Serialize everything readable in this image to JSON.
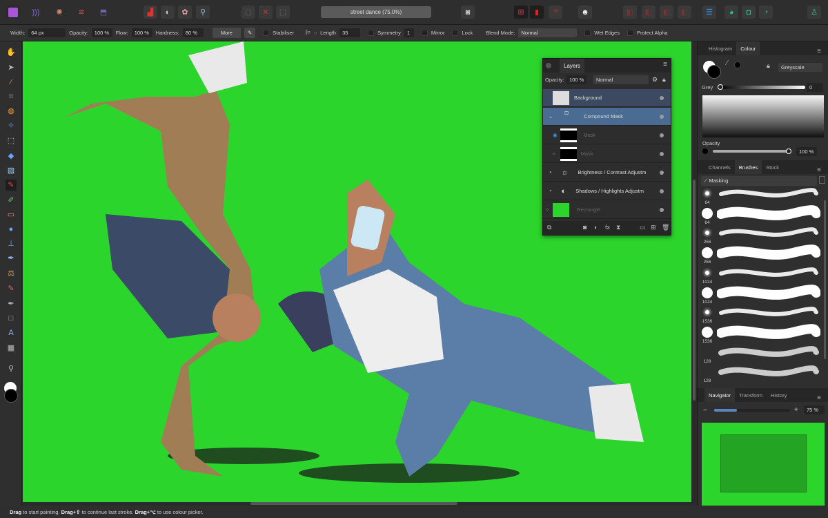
{
  "document": {
    "title": "street dance (75.0%)"
  },
  "toolbar_top": {
    "personas": [
      "photo-persona",
      "liquify-persona",
      "develop-persona",
      "tone-mapping-persona",
      "export-persona"
    ]
  },
  "context": {
    "width_label": "Width:",
    "width": "64 px",
    "opacity_label": "Opacity:",
    "opacity": "100 %",
    "flow_label": "Flow:",
    "flow": "100 %",
    "hardness_label": "Hardness:",
    "hardness": "80 %",
    "more": "More",
    "stabiliser": "Stabiliser",
    "length_label": "Length",
    "length": "35",
    "symmetry": "Symmetry",
    "symmetry_count": "1",
    "mirror": "Mirror",
    "lock": "Lock",
    "blend_label": "Blend Mode:",
    "blend": "Normal",
    "wet_edges": "Wet Edges",
    "protect_alpha": "Protect Alpha"
  },
  "layers": {
    "tab": "Layers",
    "opacity_label": "Opacity:",
    "opacity": "100 %",
    "blend": "Normal",
    "items": [
      {
        "name": "Background",
        "selected": true
      },
      {
        "name": "Compound Mask",
        "selected": true
      },
      {
        "name": "Mask",
        "dim": true
      },
      {
        "name": "Mask",
        "dim": true
      },
      {
        "name": "Brightness / Contrast Adjustm"
      },
      {
        "name": "Shadows / Highlights Adjustm"
      },
      {
        "name": "Rectangle",
        "dim": true
      }
    ]
  },
  "colour": {
    "tabs": [
      "Histogram",
      "Colour"
    ],
    "mode": "Greyscale",
    "grey_label": "Grey",
    "grey": "0",
    "opacity_label": "Opacity",
    "opacity": "100 %"
  },
  "brushes": {
    "tabs": [
      "Channels",
      "Brushes",
      "Stock"
    ],
    "category": "Masking",
    "items": [
      {
        "size": "64",
        "soft": true
      },
      {
        "size": "64",
        "soft": false
      },
      {
        "size": "256",
        "soft": true
      },
      {
        "size": "256",
        "soft": false
      },
      {
        "size": "1024",
        "soft": true
      },
      {
        "size": "1024",
        "soft": false
      },
      {
        "size": "1536",
        "soft": true
      },
      {
        "size": "1536",
        "soft": false
      },
      {
        "size": "128",
        "soft": "texture"
      },
      {
        "size": "128",
        "soft": "texture"
      }
    ]
  },
  "navigator": {
    "tabs": [
      "Navigator",
      "Transform",
      "History"
    ],
    "zoom": "75 %",
    "zoom_fraction": 0.3
  },
  "status": {
    "drag": "Drag",
    "t1": " to start painting. ",
    "drag2": "Drag+⇧",
    "t2": " to continue last stroke. ",
    "drag3": "Drag+⌥",
    "t3": " to use colour picker."
  },
  "colors": {
    "canvas": "#2bd52b",
    "selection": "#4a6b92"
  }
}
